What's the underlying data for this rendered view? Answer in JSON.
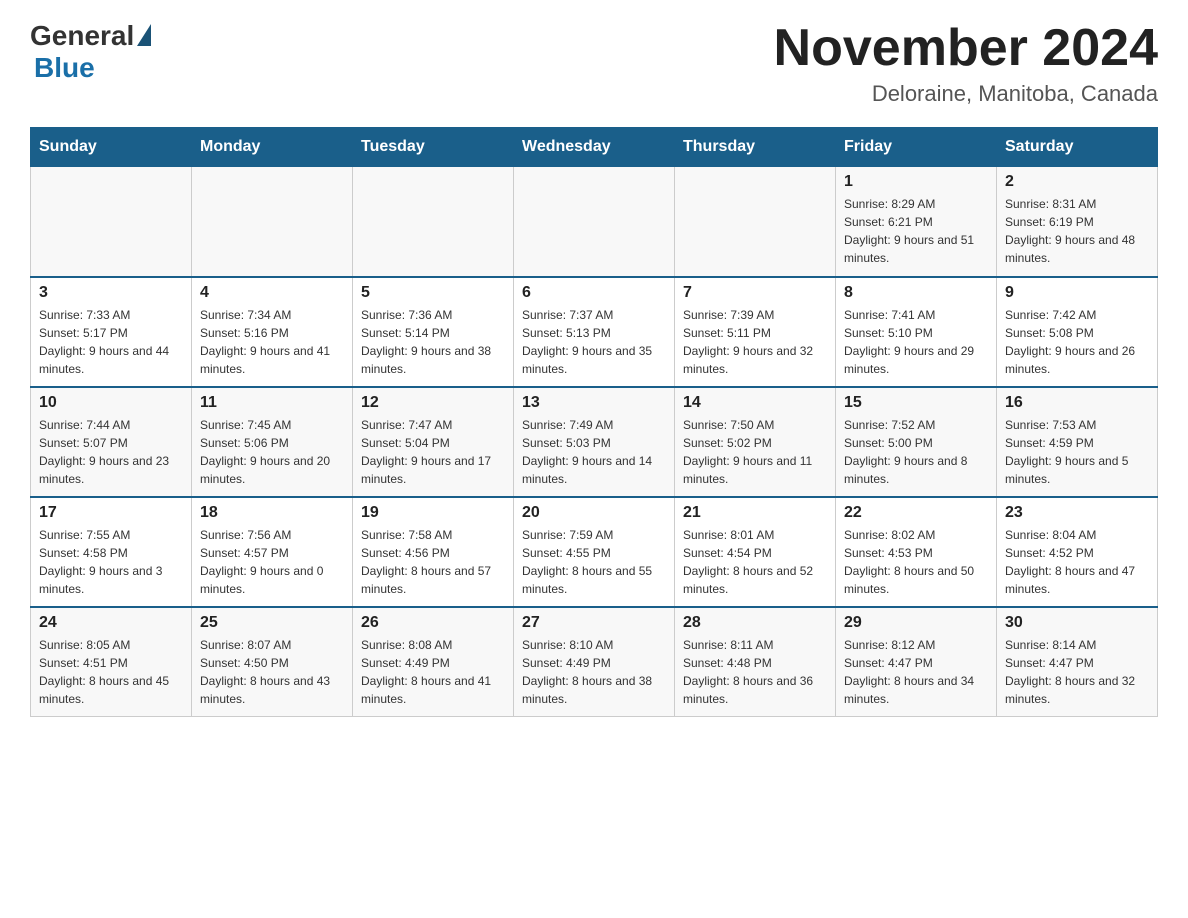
{
  "header": {
    "logo_general": "General",
    "logo_blue": "Blue",
    "title": "November 2024",
    "location": "Deloraine, Manitoba, Canada"
  },
  "weekdays": [
    "Sunday",
    "Monday",
    "Tuesday",
    "Wednesday",
    "Thursday",
    "Friday",
    "Saturday"
  ],
  "rows": [
    [
      {
        "day": "",
        "sunrise": "",
        "sunset": "",
        "daylight": ""
      },
      {
        "day": "",
        "sunrise": "",
        "sunset": "",
        "daylight": ""
      },
      {
        "day": "",
        "sunrise": "",
        "sunset": "",
        "daylight": ""
      },
      {
        "day": "",
        "sunrise": "",
        "sunset": "",
        "daylight": ""
      },
      {
        "day": "",
        "sunrise": "",
        "sunset": "",
        "daylight": ""
      },
      {
        "day": "1",
        "sunrise": "Sunrise: 8:29 AM",
        "sunset": "Sunset: 6:21 PM",
        "daylight": "Daylight: 9 hours and 51 minutes."
      },
      {
        "day": "2",
        "sunrise": "Sunrise: 8:31 AM",
        "sunset": "Sunset: 6:19 PM",
        "daylight": "Daylight: 9 hours and 48 minutes."
      }
    ],
    [
      {
        "day": "3",
        "sunrise": "Sunrise: 7:33 AM",
        "sunset": "Sunset: 5:17 PM",
        "daylight": "Daylight: 9 hours and 44 minutes."
      },
      {
        "day": "4",
        "sunrise": "Sunrise: 7:34 AM",
        "sunset": "Sunset: 5:16 PM",
        "daylight": "Daylight: 9 hours and 41 minutes."
      },
      {
        "day": "5",
        "sunrise": "Sunrise: 7:36 AM",
        "sunset": "Sunset: 5:14 PM",
        "daylight": "Daylight: 9 hours and 38 minutes."
      },
      {
        "day": "6",
        "sunrise": "Sunrise: 7:37 AM",
        "sunset": "Sunset: 5:13 PM",
        "daylight": "Daylight: 9 hours and 35 minutes."
      },
      {
        "day": "7",
        "sunrise": "Sunrise: 7:39 AM",
        "sunset": "Sunset: 5:11 PM",
        "daylight": "Daylight: 9 hours and 32 minutes."
      },
      {
        "day": "8",
        "sunrise": "Sunrise: 7:41 AM",
        "sunset": "Sunset: 5:10 PM",
        "daylight": "Daylight: 9 hours and 29 minutes."
      },
      {
        "day": "9",
        "sunrise": "Sunrise: 7:42 AM",
        "sunset": "Sunset: 5:08 PM",
        "daylight": "Daylight: 9 hours and 26 minutes."
      }
    ],
    [
      {
        "day": "10",
        "sunrise": "Sunrise: 7:44 AM",
        "sunset": "Sunset: 5:07 PM",
        "daylight": "Daylight: 9 hours and 23 minutes."
      },
      {
        "day": "11",
        "sunrise": "Sunrise: 7:45 AM",
        "sunset": "Sunset: 5:06 PM",
        "daylight": "Daylight: 9 hours and 20 minutes."
      },
      {
        "day": "12",
        "sunrise": "Sunrise: 7:47 AM",
        "sunset": "Sunset: 5:04 PM",
        "daylight": "Daylight: 9 hours and 17 minutes."
      },
      {
        "day": "13",
        "sunrise": "Sunrise: 7:49 AM",
        "sunset": "Sunset: 5:03 PM",
        "daylight": "Daylight: 9 hours and 14 minutes."
      },
      {
        "day": "14",
        "sunrise": "Sunrise: 7:50 AM",
        "sunset": "Sunset: 5:02 PM",
        "daylight": "Daylight: 9 hours and 11 minutes."
      },
      {
        "day": "15",
        "sunrise": "Sunrise: 7:52 AM",
        "sunset": "Sunset: 5:00 PM",
        "daylight": "Daylight: 9 hours and 8 minutes."
      },
      {
        "day": "16",
        "sunrise": "Sunrise: 7:53 AM",
        "sunset": "Sunset: 4:59 PM",
        "daylight": "Daylight: 9 hours and 5 minutes."
      }
    ],
    [
      {
        "day": "17",
        "sunrise": "Sunrise: 7:55 AM",
        "sunset": "Sunset: 4:58 PM",
        "daylight": "Daylight: 9 hours and 3 minutes."
      },
      {
        "day": "18",
        "sunrise": "Sunrise: 7:56 AM",
        "sunset": "Sunset: 4:57 PM",
        "daylight": "Daylight: 9 hours and 0 minutes."
      },
      {
        "day": "19",
        "sunrise": "Sunrise: 7:58 AM",
        "sunset": "Sunset: 4:56 PM",
        "daylight": "Daylight: 8 hours and 57 minutes."
      },
      {
        "day": "20",
        "sunrise": "Sunrise: 7:59 AM",
        "sunset": "Sunset: 4:55 PM",
        "daylight": "Daylight: 8 hours and 55 minutes."
      },
      {
        "day": "21",
        "sunrise": "Sunrise: 8:01 AM",
        "sunset": "Sunset: 4:54 PM",
        "daylight": "Daylight: 8 hours and 52 minutes."
      },
      {
        "day": "22",
        "sunrise": "Sunrise: 8:02 AM",
        "sunset": "Sunset: 4:53 PM",
        "daylight": "Daylight: 8 hours and 50 minutes."
      },
      {
        "day": "23",
        "sunrise": "Sunrise: 8:04 AM",
        "sunset": "Sunset: 4:52 PM",
        "daylight": "Daylight: 8 hours and 47 minutes."
      }
    ],
    [
      {
        "day": "24",
        "sunrise": "Sunrise: 8:05 AM",
        "sunset": "Sunset: 4:51 PM",
        "daylight": "Daylight: 8 hours and 45 minutes."
      },
      {
        "day": "25",
        "sunrise": "Sunrise: 8:07 AM",
        "sunset": "Sunset: 4:50 PM",
        "daylight": "Daylight: 8 hours and 43 minutes."
      },
      {
        "day": "26",
        "sunrise": "Sunrise: 8:08 AM",
        "sunset": "Sunset: 4:49 PM",
        "daylight": "Daylight: 8 hours and 41 minutes."
      },
      {
        "day": "27",
        "sunrise": "Sunrise: 8:10 AM",
        "sunset": "Sunset: 4:49 PM",
        "daylight": "Daylight: 8 hours and 38 minutes."
      },
      {
        "day": "28",
        "sunrise": "Sunrise: 8:11 AM",
        "sunset": "Sunset: 4:48 PM",
        "daylight": "Daylight: 8 hours and 36 minutes."
      },
      {
        "day": "29",
        "sunrise": "Sunrise: 8:12 AM",
        "sunset": "Sunset: 4:47 PM",
        "daylight": "Daylight: 8 hours and 34 minutes."
      },
      {
        "day": "30",
        "sunrise": "Sunrise: 8:14 AM",
        "sunset": "Sunset: 4:47 PM",
        "daylight": "Daylight: 8 hours and 32 minutes."
      }
    ]
  ]
}
